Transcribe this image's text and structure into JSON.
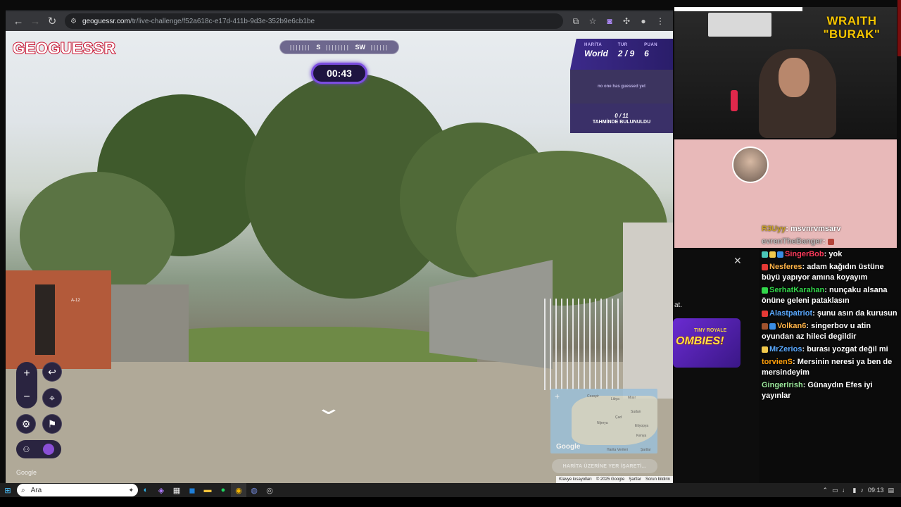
{
  "browser": {
    "url_host": "geoguessr.com",
    "url_path": "/tr/live-challenge/f52a618c-e17d-411b-9d3e-352b9e6cb1be",
    "back_icon": "back-arrow-icon",
    "reload_icon": "reload-icon"
  },
  "game": {
    "logo": "GEOGUESSR",
    "compass": {
      "left": "S",
      "right": "SW"
    },
    "timer": "00:43",
    "score": {
      "map_label": "HARİTA",
      "map_value": "World",
      "round_label": "TUR",
      "round_value": "2 / 9",
      "points_label": "PUAN",
      "points_value": "6"
    },
    "guess_status": "no one has guessed yet",
    "found_count": "0 / 11",
    "found_label": "TAHMİNDE BULUNULDU",
    "zoom_in": "+",
    "zoom_out": "−",
    "google_watermark": "Google",
    "minimap_google": "Google",
    "minimap_labels": [
      "Cezayir",
      "Libya",
      "Mısır",
      "Sudan",
      "Nijerya",
      "Çad",
      "Etiyopya",
      "Kenya",
      "Harita Verileri",
      "Şartlar"
    ],
    "guess_button": "HARİTA ÜZERİNE YER İŞARETİ...",
    "footer": [
      "Klavye kısayolları",
      "© 2025 Google",
      "Şartlar",
      "Sorun bildirin"
    ],
    "street_sign": "A-12"
  },
  "stream": {
    "streamer_line1": "WRAITH",
    "streamer_line2": "\"BURAK\"",
    "partial_text": "at.",
    "ad_small": "TINY ROYALE",
    "ad_big": "OMBIES!"
  },
  "chat": [
    {
      "user": "R3Uyy",
      "text": "msvnrvmsarv",
      "color": "#c9a227"
    },
    {
      "user": "evrenTheBanger",
      "text": "",
      "color": "#bbbbbb"
    },
    {
      "user": "SingerBob",
      "text": "yok",
      "color": "#ff3b5c"
    },
    {
      "user": "Nesferes",
      "text": "adam kağıdın üstüne büyü yapıyor amına koyayım",
      "color": "#ffb347"
    },
    {
      "user": "SerhatKarahan",
      "text": "nunçaku alsana önüne geleni pataklasın",
      "color": "#32d74b"
    },
    {
      "user": "Alastpatriot",
      "text": "şunu asın da kurusun",
      "color": "#5aa9ff"
    },
    {
      "user": "Volkan6",
      "text": "singerbov u atin oyundan az hileci degildir",
      "color": "#ffb347"
    },
    {
      "user": "MrZerios",
      "text": "burası yozgat değil mi",
      "color": "#5aa9ff"
    },
    {
      "user": "torvienS",
      "text": "Mersinin neresi ya ben de mersindeyim",
      "color": "#ff9f0a"
    },
    {
      "user": "GingerIrish",
      "text": "Günaydın Efes iyi yayınlar",
      "color": "#9be89b"
    }
  ],
  "taskbar": {
    "search_placeholder": "Ara",
    "time": "09:13"
  }
}
